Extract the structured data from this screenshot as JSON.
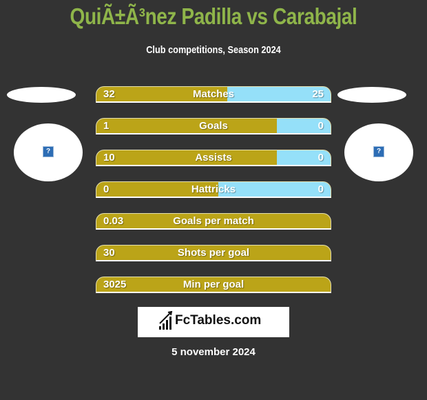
{
  "title": "QuiÃ±Ã³nez Padilla vs Carabajal",
  "subtitle": "Club competitions, Season 2024",
  "colors": {
    "left_bar": "#bba418",
    "right_bar": "#95e0f9",
    "title": "#8fb54a",
    "background": "#333333"
  },
  "players": {
    "left": {
      "badge_icon": "missing-image-icon"
    },
    "right": {
      "badge_icon": "missing-image-icon"
    }
  },
  "stats": [
    {
      "label": "Matches",
      "left": "32",
      "right": "25",
      "right_share": 0.44
    },
    {
      "label": "Goals",
      "left": "1",
      "right": "0",
      "right_share": 0.23
    },
    {
      "label": "Assists",
      "left": "10",
      "right": "0",
      "right_share": 0.23
    },
    {
      "label": "Hattricks",
      "left": "0",
      "right": "0",
      "right_share": 0.48
    },
    {
      "label": "Goals per match",
      "left": "0.03",
      "right": "",
      "right_share": 0
    },
    {
      "label": "Shots per goal",
      "left": "30",
      "right": "",
      "right_share": 0
    },
    {
      "label": "Min per goal",
      "left": "3025",
      "right": "",
      "right_share": 0
    }
  ],
  "logo": {
    "text": "FcTables.com",
    "icon": "bar-chart-icon"
  },
  "date": "5 november 2024"
}
